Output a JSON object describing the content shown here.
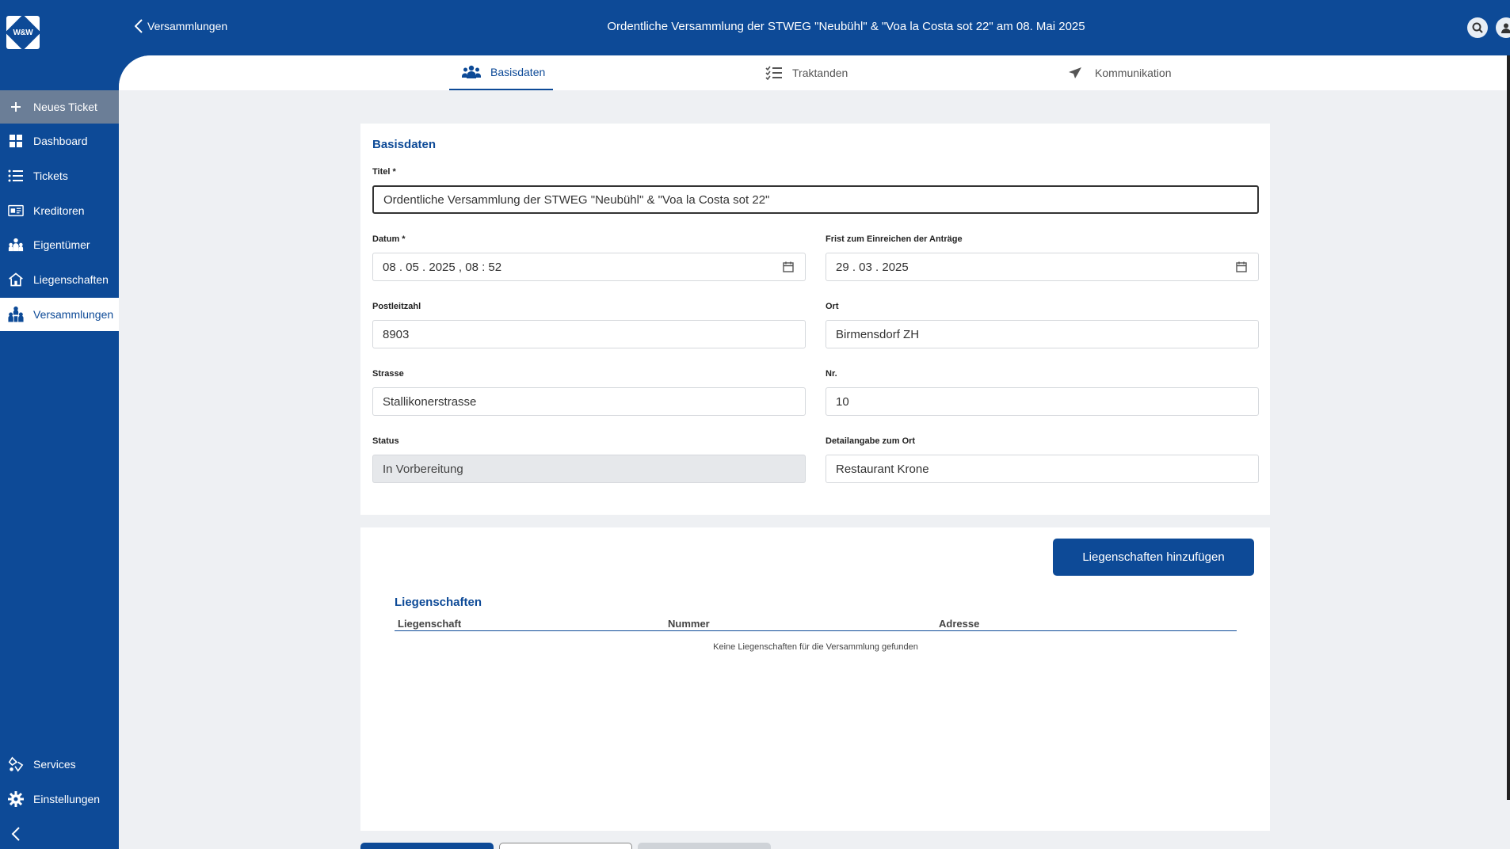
{
  "app": {
    "logo_text": "W&W"
  },
  "sidebar": {
    "new_ticket": "Neues Ticket",
    "items": [
      {
        "label": "Dashboard",
        "icon": "dashboard-icon"
      },
      {
        "label": "Tickets",
        "icon": "list-icon"
      },
      {
        "label": "Kreditoren",
        "icon": "creditor-card-icon"
      },
      {
        "label": "Eigentümer",
        "icon": "people-icon"
      },
      {
        "label": "Liegenschaften",
        "icon": "house-icon"
      },
      {
        "label": "Versammlungen",
        "icon": "assembly-icon"
      }
    ],
    "bottom_items": [
      {
        "label": "Services",
        "icon": "services-icon"
      },
      {
        "label": "Einstellungen",
        "icon": "gear-icon"
      }
    ]
  },
  "header": {
    "back_label": "Versammlungen",
    "title": "Ordentliche Versammlung der STWEG \"Neubühl\" & \"Voa la Costa sot 22\" am 08. Mai 2025"
  },
  "tabs": [
    {
      "label": "Basisdaten",
      "icon": "group-icon",
      "active": true
    },
    {
      "label": "Traktanden",
      "icon": "checklist-icon",
      "active": false
    },
    {
      "label": "Kommunikation",
      "icon": "paper-plane-icon",
      "active": false
    }
  ],
  "form": {
    "section_title": "Basisdaten",
    "titel_label": "Titel *",
    "titel_value": "Ordentliche Versammlung der STWEG \"Neubühl\" & \"Voa la Costa sot 22\"",
    "datum_label": "Datum *",
    "datum_value": "08 . 05 . 2025 , 08 : 52",
    "frist_label": "Frist zum Einreichen der Anträge",
    "frist_value": "29 . 03 . 2025",
    "plz_label": "Postleitzahl",
    "plz_value": "8903",
    "ort_label": "Ort",
    "ort_value": "Birmensdorf ZH",
    "strasse_label": "Strasse",
    "strasse_value": "Stallikonerstrasse",
    "nr_label": "Nr.",
    "nr_value": "10",
    "status_label": "Status",
    "status_value": "In Vorbereitung",
    "detail_label": "Detailangabe zum Ort",
    "detail_value": "Restaurant Krone"
  },
  "properties": {
    "add_button": "Liegenschaften hinzufügen",
    "section_title": "Liegenschaften",
    "columns": [
      "Liegenschaft",
      "Nummer",
      "Adresse"
    ],
    "empty_message": "Keine Liegenschaften für die Versammlung gefunden"
  },
  "colors": {
    "primary": "#0d4a97",
    "background": "#eef0f3",
    "new_ticket_bg": "#6b7e97"
  }
}
